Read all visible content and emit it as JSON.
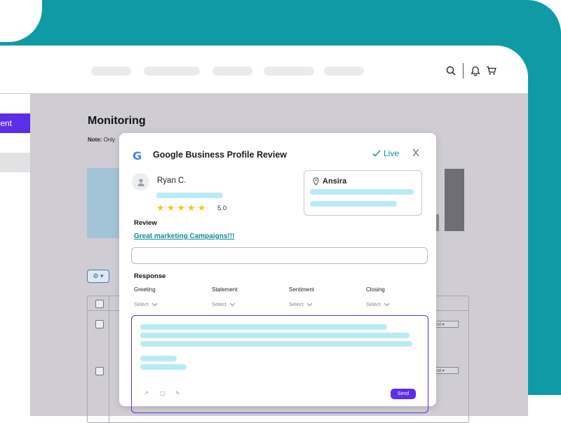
{
  "theme": {
    "teal": "#0f9aa5",
    "accent": "#5b2ee8",
    "link": "#0a8f9b",
    "placeholder_bar": "#b9ebf7"
  },
  "sidebar": {
    "active_label": "ent"
  },
  "header_icons": [
    "search-icon",
    "bell-icon",
    "cart-icon"
  ],
  "page": {
    "title": "Monitoring",
    "note_label": "Note:",
    "note_text": "Only"
  },
  "background_table": {
    "dropdown_label": "ond"
  },
  "modal": {
    "title": "Google Business Profile Review",
    "provider_logo": "G",
    "status": "Live",
    "close_label": "X",
    "reviewer": {
      "name": "Ryan C.",
      "rating": 5,
      "rating_label": "5.0"
    },
    "location": {
      "name": "Ansira"
    },
    "review": {
      "section_label": "Review",
      "text": "Great marketing Campaigns!!!"
    },
    "response": {
      "section_label": "Response",
      "columns": [
        {
          "label": "Greeting",
          "placeholder": "Select"
        },
        {
          "label": "Statement",
          "placeholder": "Select"
        },
        {
          "label": "Sentiment",
          "placeholder": "Select"
        },
        {
          "label": "Closing",
          "placeholder": "Select"
        }
      ],
      "send_label": "Send"
    }
  }
}
